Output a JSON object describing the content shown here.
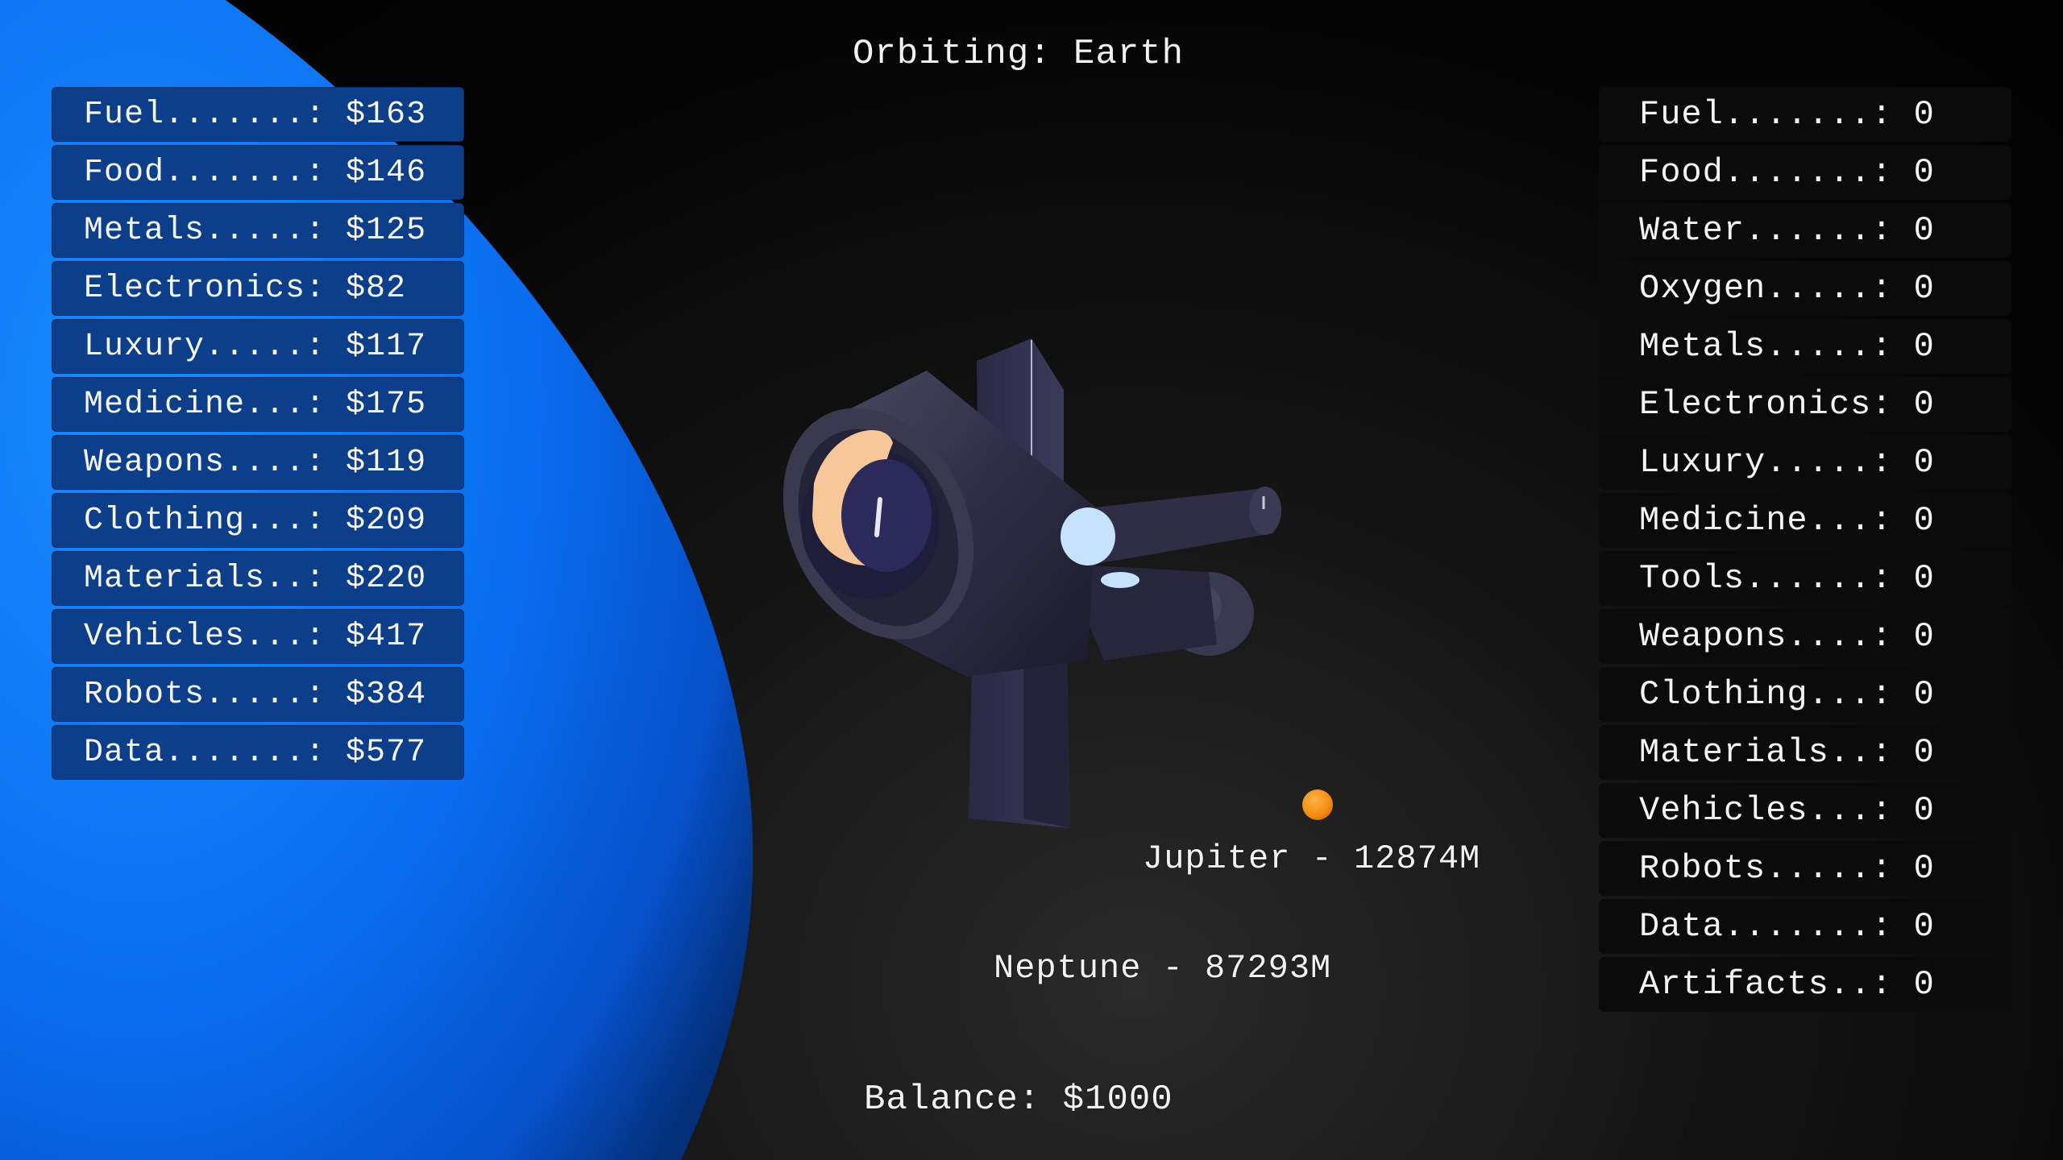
{
  "hud": {
    "orbiting": "Orbiting: Earth",
    "balance": "Balance: $1000"
  },
  "destinations": [
    {
      "label": "Jupiter - 12874M",
      "color": "#f08a10"
    },
    {
      "label": "Neptune - 87293M"
    }
  ],
  "market": [
    {
      "label": "Fuel.......: $163"
    },
    {
      "label": "Food.......: $146"
    },
    {
      "label": "Metals.....: $125"
    },
    {
      "label": "Electronics: $82"
    },
    {
      "label": "Luxury.....: $117"
    },
    {
      "label": "Medicine...: $175"
    },
    {
      "label": "Weapons....: $119"
    },
    {
      "label": "Clothing...: $209"
    },
    {
      "label": "Materials..: $220"
    },
    {
      "label": "Vehicles...: $417"
    },
    {
      "label": "Robots.....: $384"
    },
    {
      "label": "Data.......: $577"
    }
  ],
  "cargo": [
    {
      "label": "Fuel.......: 0"
    },
    {
      "label": "Food.......: 0"
    },
    {
      "label": "Water......: 0"
    },
    {
      "label": "Oxygen.....: 0"
    },
    {
      "label": "Metals.....: 0"
    },
    {
      "label": "Electronics: 0"
    },
    {
      "label": "Luxury.....: 0"
    },
    {
      "label": "Medicine...: 0"
    },
    {
      "label": "Tools......: 0"
    },
    {
      "label": "Weapons....: 0"
    },
    {
      "label": "Clothing...: 0"
    },
    {
      "label": "Materials..: 0"
    },
    {
      "label": "Vehicles...: 0"
    },
    {
      "label": "Robots.....: 0"
    },
    {
      "label": "Data.......: 0"
    },
    {
      "label": "Artifacts..: 0"
    }
  ],
  "colors": {
    "planet": "#0a6df0",
    "panel": "#0d3e8a",
    "ship": "#2e2d45"
  },
  "icons": {
    "planet": "earth-planet",
    "ship": "spaceship",
    "destination_marker": "jupiter-dot"
  }
}
